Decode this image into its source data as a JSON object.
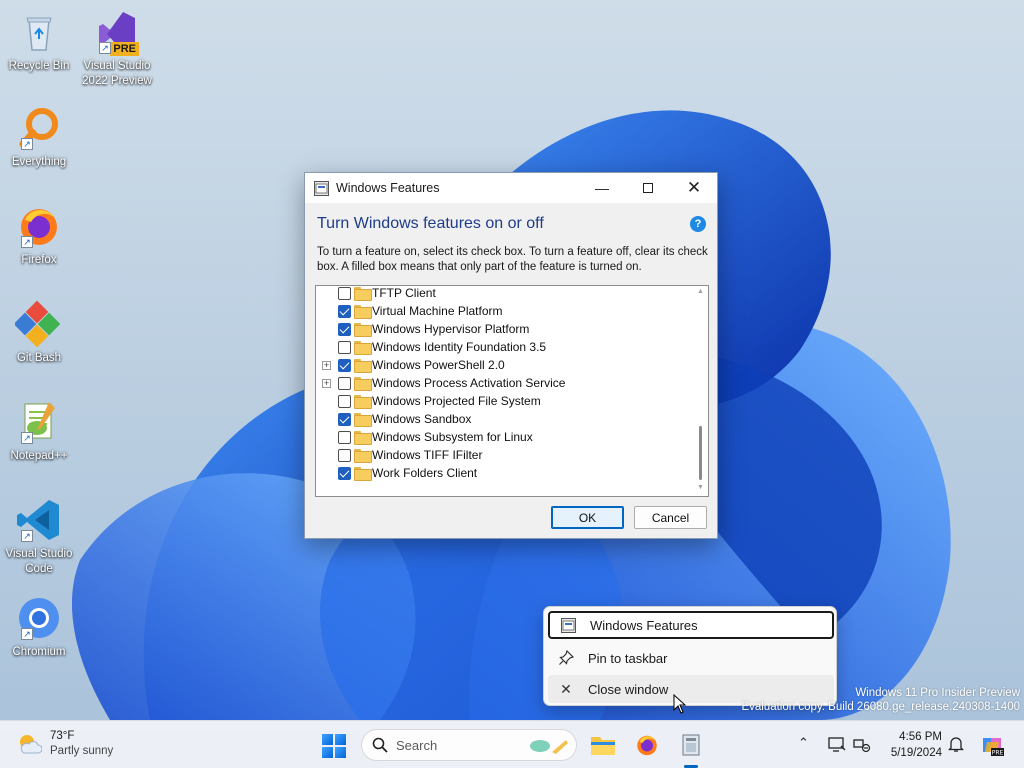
{
  "desktop": {
    "icons": [
      {
        "label": "Recycle Bin"
      },
      {
        "label": "Visual Studio 2022 Preview",
        "badge": "PRE"
      },
      {
        "label": "Everything"
      },
      {
        "label": "Firefox"
      },
      {
        "label": "Git Bash"
      },
      {
        "label": "Notepad++"
      },
      {
        "label": "Visual Studio Code"
      },
      {
        "label": "Chromium"
      }
    ]
  },
  "dialog": {
    "title": "Windows Features",
    "heading": "Turn Windows features on or off",
    "help": "?",
    "description": "To turn a feature on, select its check box. To turn a feature off, clear its check box. A filled box means that only part of the feature is turned on.",
    "features": [
      {
        "label": "TFTP Client",
        "checked": false,
        "expandable": false
      },
      {
        "label": "Virtual Machine Platform",
        "checked": true,
        "expandable": false
      },
      {
        "label": "Windows Hypervisor Platform",
        "checked": true,
        "expandable": false
      },
      {
        "label": "Windows Identity Foundation 3.5",
        "checked": false,
        "expandable": false
      },
      {
        "label": "Windows PowerShell 2.0",
        "checked": true,
        "expandable": true
      },
      {
        "label": "Windows Process Activation Service",
        "checked": false,
        "expandable": true
      },
      {
        "label": "Windows Projected File System",
        "checked": false,
        "expandable": false
      },
      {
        "label": "Windows Sandbox",
        "checked": true,
        "expandable": false
      },
      {
        "label": "Windows Subsystem for Linux",
        "checked": false,
        "expandable": false
      },
      {
        "label": "Windows TIFF IFilter",
        "checked": false,
        "expandable": false
      },
      {
        "label": "Work Folders Client",
        "checked": true,
        "expandable": false
      }
    ],
    "ok_label": "OK",
    "cancel_label": "Cancel"
  },
  "context_menu": {
    "items": [
      {
        "label": "Windows Features",
        "icon": "windows-features-icon",
        "state": "focused"
      },
      {
        "label": "Pin to taskbar",
        "icon": "pin-icon",
        "state": "normal"
      },
      {
        "label": "Close window",
        "icon": "close-icon",
        "state": "hover"
      }
    ]
  },
  "watermark": {
    "line1": "Windows 11 Pro Insider Preview",
    "line2": "Evaluation copy. Build 26080.ge_release.240308-1400"
  },
  "taskbar": {
    "weather": {
      "temp": "73°F",
      "condition": "Partly sunny"
    },
    "search_placeholder": "Search",
    "clock": {
      "time": "4:56 PM",
      "date": "5/19/2024"
    }
  },
  "colors": {
    "accent": "#0067c0",
    "checkbox_checked": "#1f5fbf",
    "heading": "#1f3c88",
    "wallpaper_bloom": "#1a56d6"
  }
}
